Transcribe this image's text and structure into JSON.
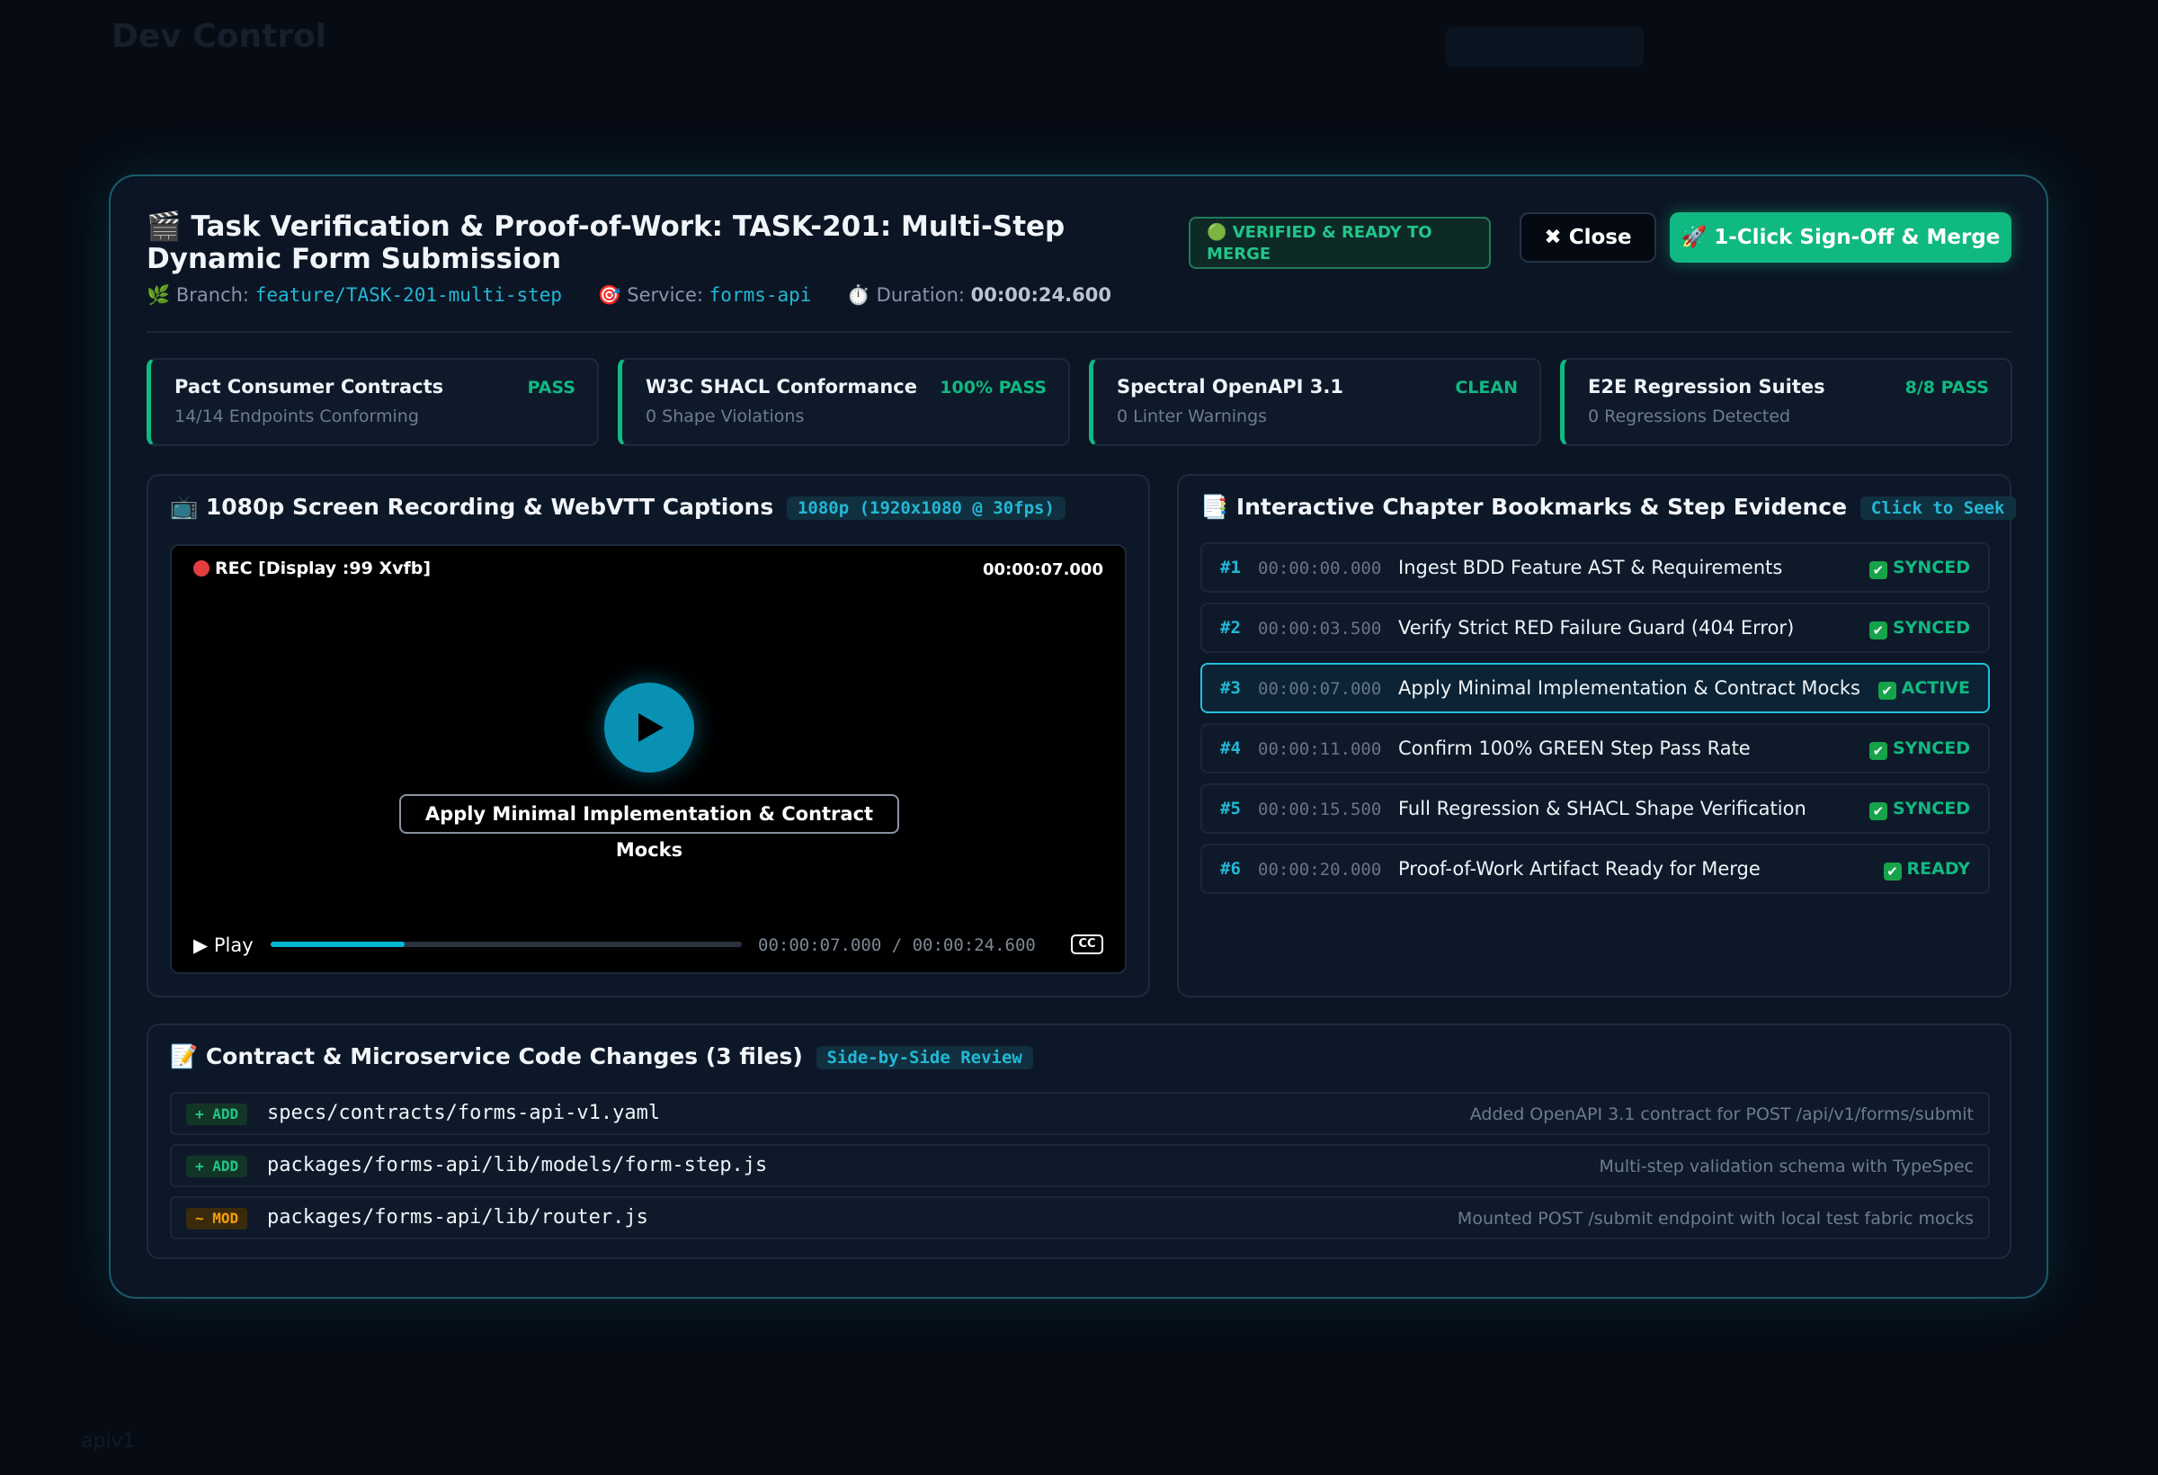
{
  "background": {
    "title": "Dev Control",
    "footer": "apiv1"
  },
  "header": {
    "title": "🎬 Task Verification & Proof-of-Work: TASK-201: Multi-Step Dynamic Form Submission",
    "branch_label": "Branch:",
    "branch": "feature/TASK-201-multi-step",
    "service_label": "Service:",
    "service": "forms-api",
    "duration_label": "Duration:",
    "duration": "00:00:24.600",
    "status": "VERIFIED & READY TO MERGE",
    "close_label": "✖ Close",
    "merge_label": "🚀 1-Click Sign-Off & Merge"
  },
  "stats": [
    {
      "label": "Pact Consumer Contracts",
      "sub": "14/14 Endpoints Conforming",
      "value": "PASS"
    },
    {
      "label": "W3C SHACL Conformance",
      "sub": "0 Shape Violations",
      "value": "100% PASS"
    },
    {
      "label": "Spectral OpenAPI 3.1",
      "sub": "0 Linter Warnings",
      "value": "CLEAN"
    },
    {
      "label": "E2E Regression Suites",
      "sub": "0 Regressions Detected",
      "value": "8/8 PASS"
    }
  ],
  "video": {
    "title": "📺 1080p Screen Recording & WebVTT Captions",
    "tag": "1080p (1920x1080 @ 30fps)",
    "rec_label": "REC [Display :99 Xvfb]",
    "timestamp": "00:00:07.000",
    "caption": "Apply Minimal Implementation & Contract Mocks",
    "play_label": "▶ Play",
    "time_display": "00:00:07.000 / 00:00:24.600",
    "cc_label": "CC",
    "progress": 0.285
  },
  "chapters": {
    "title": "📑 Interactive Chapter Bookmarks & Step Evidence",
    "tag": "Click to Seek",
    "items": [
      {
        "num": "#1",
        "time": "00:00:00.000",
        "label": "Ingest BDD Feature AST & Requirements",
        "status": "SYNCED"
      },
      {
        "num": "#2",
        "time": "00:00:03.500",
        "label": "Verify Strict RED Failure Guard (404 Error)",
        "status": "SYNCED"
      },
      {
        "num": "#3",
        "time": "00:00:07.000",
        "label": "Apply Minimal Implementation & Contract Mocks",
        "status": "ACTIVE"
      },
      {
        "num": "#4",
        "time": "00:00:11.000",
        "label": "Confirm 100% GREEN Step Pass Rate",
        "status": "SYNCED"
      },
      {
        "num": "#5",
        "time": "00:00:15.500",
        "label": "Full Regression & SHACL Shape Verification",
        "status": "SYNCED"
      },
      {
        "num": "#6",
        "time": "00:00:20.000",
        "label": "Proof-of-Work Artifact Ready for Merge",
        "status": "READY"
      }
    ]
  },
  "changes": {
    "title": "📝 Contract & Microservice Code Changes (3 files)",
    "tag": "Side-by-Side Review",
    "files": [
      {
        "badge": "+ ADD",
        "path": "specs/contracts/forms-api-v1.yaml",
        "desc": "Added OpenAPI 3.1 contract for POST /api/v1/forms/submit"
      },
      {
        "badge": "+ ADD",
        "path": "packages/forms-api/lib/models/form-step.js",
        "desc": "Multi-step validation schema with TypeSpec"
      },
      {
        "badge": "~ MOD",
        "path": "packages/forms-api/lib/router.js",
        "desc": "Mounted POST /submit endpoint with local test fabric mocks"
      }
    ]
  },
  "colors": {
    "accent": "#22b8d6",
    "success": "#10b981",
    "modified": "#f59e0b",
    "record": "#e53e3e"
  }
}
